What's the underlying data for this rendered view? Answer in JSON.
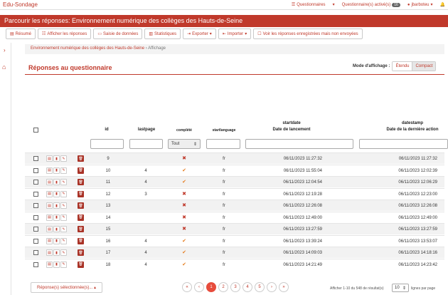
{
  "brand": "Edu-Sondage",
  "topnav": {
    "questionnaires": "Questionnaires",
    "active": "Questionnaire(s) activé(s)",
    "active_count": "16",
    "user": "jbarboteu"
  },
  "page_title": "Parcourir les réponses: Environnement numérique des collèges des Hauts-de-Seine",
  "toolbar": [
    "Résumé",
    "Afficher les réponses",
    "Saisie de données",
    "Statistiques",
    "Exporter",
    "Importer",
    "Voir les réponses enregistrées mais non envoyées"
  ],
  "breadcrumb": {
    "parent": "Environnement numérique des collèges des Hauts-de-Seine",
    "sep": "›",
    "current": "Affichage"
  },
  "section_title": "Réponses au questionnaire",
  "mode": {
    "label": "Mode d'affichage :",
    "opt1": "Étendu",
    "opt2": "Compact"
  },
  "columns": {
    "id": "id",
    "lastpage": "lastpage",
    "complete": "complété",
    "startlanguage": "startlanguage",
    "startdate": "startdate",
    "startdate_sub": "Date de lancement",
    "datestamp": "datestamp",
    "datestamp_sub": "Date de la dernière action"
  },
  "filter_select": "Tout",
  "rows": [
    {
      "id": "9",
      "lastpage": "",
      "complete": "no",
      "lang": "fr",
      "start": "06/11/2023 11:27:32",
      "stamp": "06/11/2023 11:27:32"
    },
    {
      "id": "10",
      "lastpage": "4",
      "complete": "yes",
      "lang": "fr",
      "start": "06/11/2023 11:55:04",
      "stamp": "06/11/2023 12:02:39"
    },
    {
      "id": "11",
      "lastpage": "4",
      "complete": "yes",
      "lang": "fr",
      "start": "06/11/2023 12:04:54",
      "stamp": "06/11/2023 12:06:29"
    },
    {
      "id": "12",
      "lastpage": "3",
      "complete": "no",
      "lang": "fr",
      "start": "06/11/2023 12:19:28",
      "stamp": "06/11/2023 12:23:00"
    },
    {
      "id": "13",
      "lastpage": "",
      "complete": "no",
      "lang": "fr",
      "start": "06/11/2023 12:26:08",
      "stamp": "06/11/2023 12:26:08"
    },
    {
      "id": "14",
      "lastpage": "",
      "complete": "no",
      "lang": "fr",
      "start": "06/11/2023 12:49:00",
      "stamp": "06/11/2023 12:49:00"
    },
    {
      "id": "15",
      "lastpage": "",
      "complete": "no",
      "lang": "fr",
      "start": "06/11/2023 13:27:59",
      "stamp": "06/11/2023 13:27:59"
    },
    {
      "id": "16",
      "lastpage": "4",
      "complete": "yes",
      "lang": "fr",
      "start": "06/11/2023 13:39:24",
      "stamp": "06/11/2023 13:53:07"
    },
    {
      "id": "17",
      "lastpage": "4",
      "complete": "yes",
      "lang": "fr",
      "start": "06/11/2023 14:09:03",
      "stamp": "06/11/2023 14:18:16"
    },
    {
      "id": "18",
      "lastpage": "4",
      "complete": "yes",
      "lang": "fr",
      "start": "06/11/2023 14:21:49",
      "stamp": "06/11/2023 14:23:42"
    }
  ],
  "footer": {
    "selected": "Réponse(s) sélectionnée(s)...",
    "pages": [
      "«",
      "‹",
      "1",
      "2",
      "3",
      "4",
      "5",
      "›",
      "»"
    ],
    "info": "Afficher 1-10 du 548 de résultat(s)",
    "perpage": "10",
    "perpage_label": "lignes par page"
  },
  "colors": {
    "accent": "#c0392b"
  }
}
